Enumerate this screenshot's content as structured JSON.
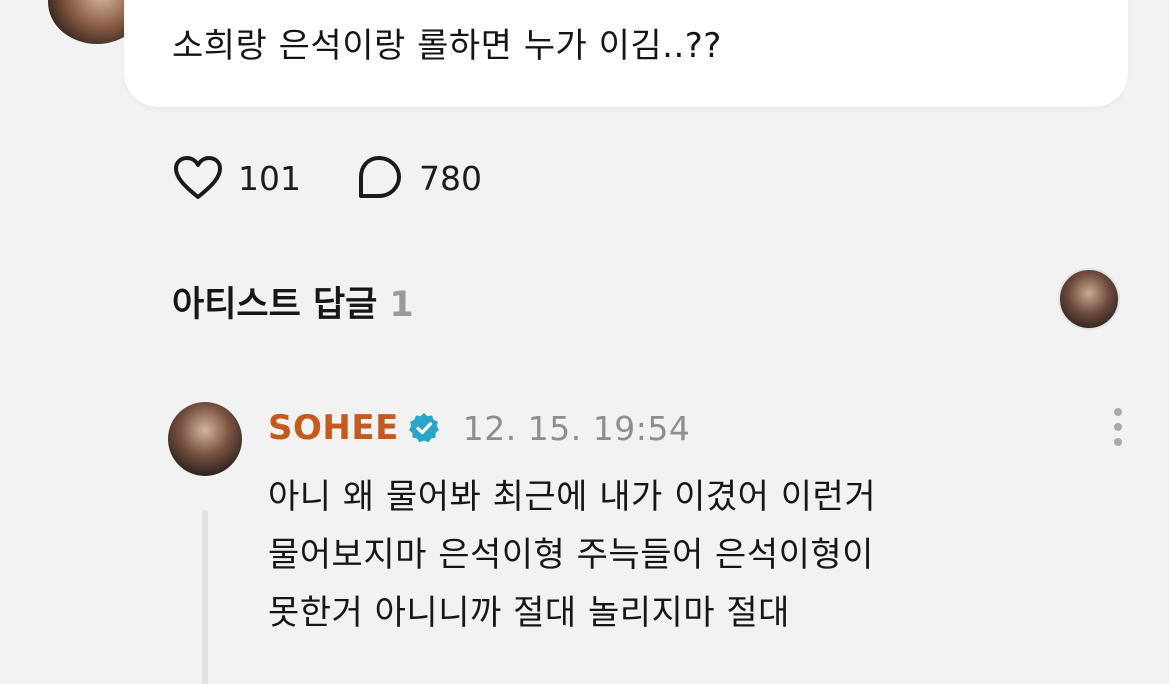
{
  "post": {
    "text": "소희랑 은석이랑 롤하면 누가 이김..??"
  },
  "actions": {
    "likes": "101",
    "comments": "780"
  },
  "artist_replies": {
    "title": "아티스트 답글",
    "count": "1"
  },
  "reply": {
    "author": "SOHEE",
    "timestamp": "12. 15. 19:54",
    "lines": [
      "아니 왜 물어봐 최근에 내가 이겼어 이런거",
      "물어보지마 은석이형 주늑들어 은석이형이",
      "못한거 아니니까 절대 놀리지마 절대"
    ]
  },
  "colors": {
    "author": "#c45a1d",
    "verified": "#2aa6c9",
    "muted": "#8e8e8e",
    "count_muted": "#9b9b9b"
  },
  "icons": {
    "like": "heart-icon",
    "comment": "speech-bubble-icon",
    "verified": "verified-badge-icon",
    "more": "more-vertical-icon"
  }
}
